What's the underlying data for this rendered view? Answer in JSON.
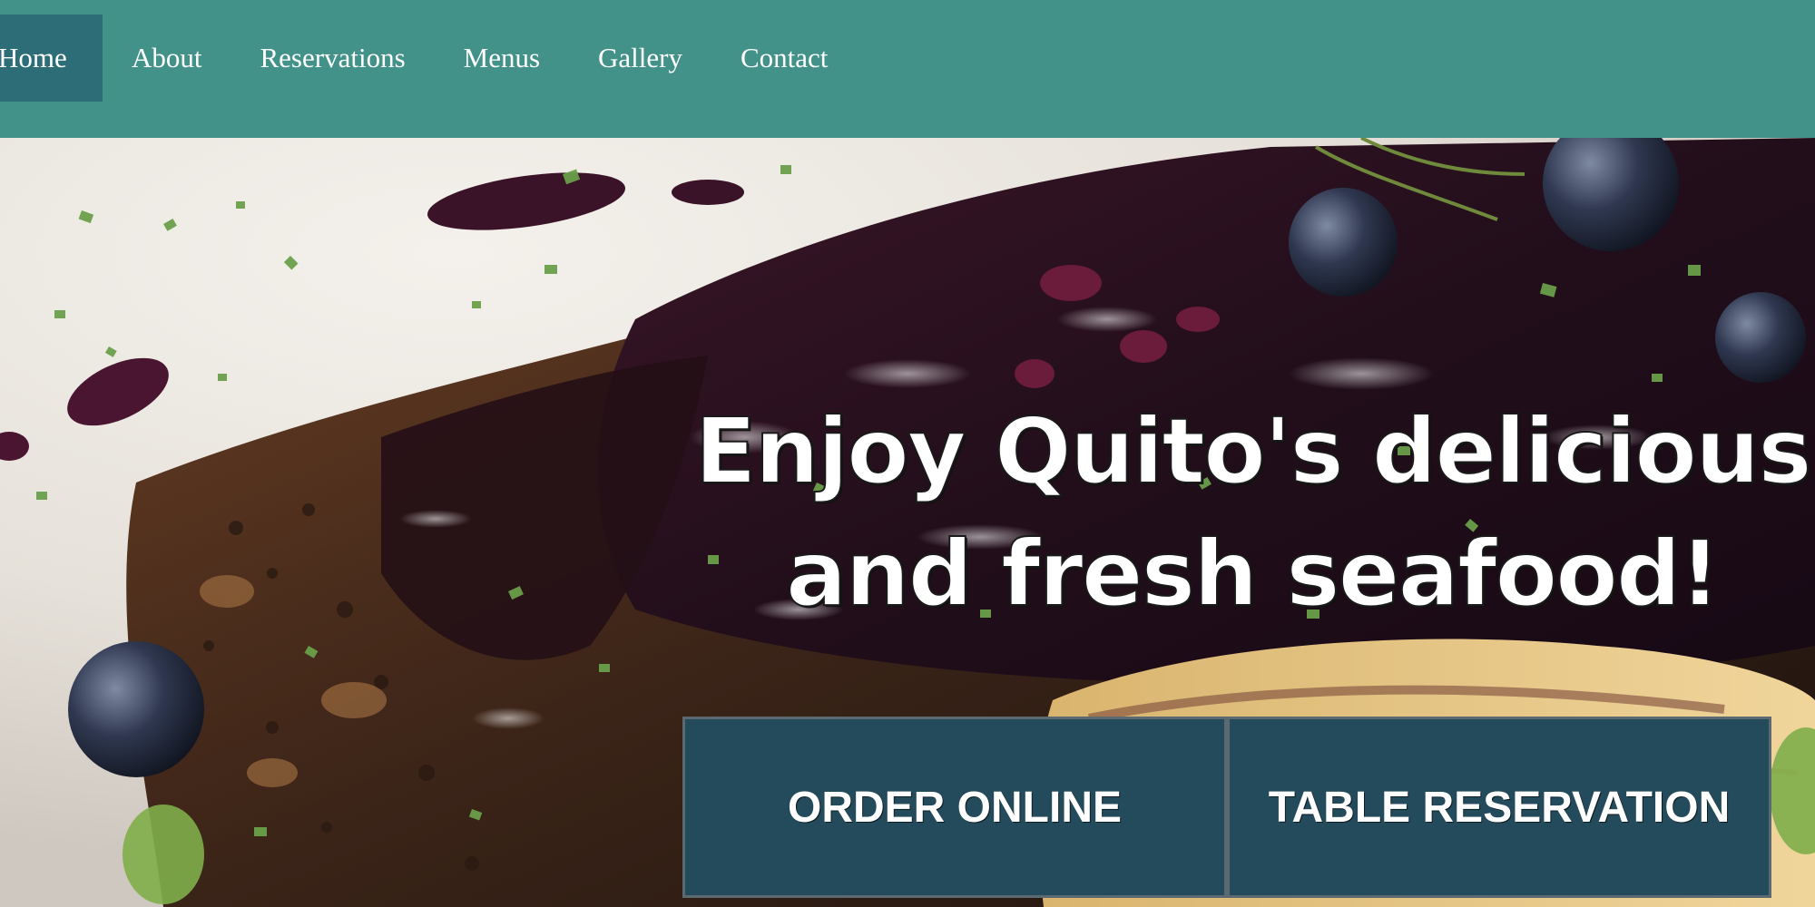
{
  "nav": {
    "items": [
      {
        "label": "Home",
        "active": true
      },
      {
        "label": "About",
        "active": false
      },
      {
        "label": "Reservations",
        "active": false
      },
      {
        "label": "Menus",
        "active": false
      },
      {
        "label": "Gallery",
        "active": false
      },
      {
        "label": "Contact",
        "active": false
      }
    ]
  },
  "hero": {
    "headline_line1": "Enjoy Quito's delicious",
    "headline_line2": "and fresh seafood!",
    "image_subject": "blackened fish with blueberry glaze and herbs"
  },
  "cta": {
    "order_label": "ORDER ONLINE",
    "reserve_label": "TABLE RESERVATION"
  },
  "colors": {
    "nav_bg": "#42928a",
    "nav_active_bg": "#2c6d77",
    "button_bg": "#244b5c",
    "text": "#ffffff"
  }
}
